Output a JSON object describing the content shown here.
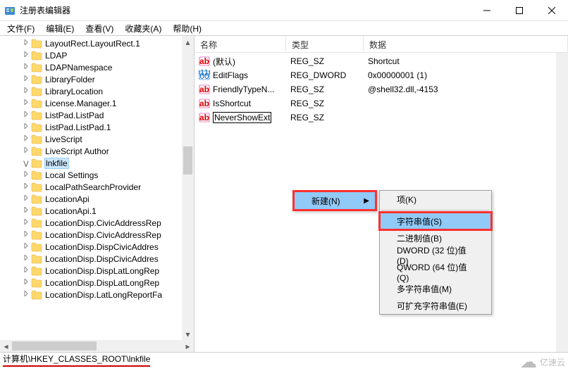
{
  "window": {
    "title": "注册表编辑器",
    "controls": {
      "minimize": "minimize-icon",
      "maximize": "maximize-icon",
      "close": "close-icon"
    }
  },
  "menubar": [
    "文件(F)",
    "编辑(E)",
    "查看(V)",
    "收藏夹(A)",
    "帮助(H)"
  ],
  "tree": {
    "items": [
      "LayoutRect.LayoutRect.1",
      "LDAP",
      "LDAPNamespace",
      "LibraryFolder",
      "LibraryLocation",
      "License.Manager.1",
      "ListPad.ListPad",
      "ListPad.ListPad.1",
      "LiveScript",
      "LiveScript Author",
      "lnkfile",
      "Local Settings",
      "LocalPathSearchProvider",
      "LocationApi",
      "LocationApi.1",
      "LocationDisp.CivicAddressRep",
      "LocationDisp.CivicAddressRep",
      "LocationDisp.DispCivicAddres",
      "LocationDisp.DispCivicAddres",
      "LocationDisp.DispLatLongRep",
      "LocationDisp.DispLatLongRep",
      "LocationDisp.LatLongReportFa"
    ],
    "selected_index": 10
  },
  "list": {
    "columns": [
      "名称",
      "类型",
      "数据"
    ],
    "rows": [
      {
        "icon": "string",
        "name": "(默认)",
        "type": "REG_SZ",
        "data": "Shortcut"
      },
      {
        "icon": "binary",
        "name": "EditFlags",
        "type": "REG_DWORD",
        "data": "0x00000001 (1)"
      },
      {
        "icon": "string",
        "name": "FriendlyTypeN...",
        "type": "REG_SZ",
        "data": "@shell32.dll,-4153"
      },
      {
        "icon": "string",
        "name": "IsShortcut",
        "type": "REG_SZ",
        "data": ""
      },
      {
        "icon": "string",
        "name": "NeverShowExt",
        "type": "REG_SZ",
        "data": "",
        "editing": true
      }
    ]
  },
  "context_menu": {
    "parent": {
      "label": "新建(N)",
      "has_submenu": true
    },
    "submenu": [
      "项(K)",
      "字符串值(S)",
      "二进制值(B)",
      "DWORD (32 位)值(D)",
      "QWORD (64 位)值(Q)",
      "多字符串值(M)",
      "可扩充字符串值(E)"
    ],
    "submenu_highlight_index": 1
  },
  "statusbar": {
    "path": "计算机\\HKEY_CLASSES_ROOT\\lnkfile"
  },
  "watermark": "亿速云"
}
